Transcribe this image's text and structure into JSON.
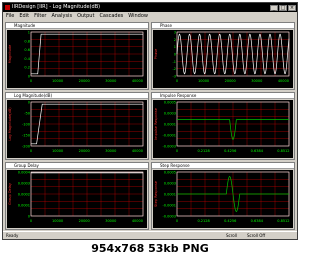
{
  "window": {
    "title": "IIRDesign [IIR] - Log Magnitude(dB)"
  },
  "menu": [
    "File",
    "Edit",
    "Filter",
    "Analysis",
    "Output",
    "Cascades",
    "Window"
  ],
  "panels": [
    {
      "title": "Magnitude",
      "ylabels": [
        "1",
        "0.8",
        "0.6",
        "0.4",
        "0.2",
        "0"
      ],
      "xlabels": [
        "0",
        "10000",
        "20000",
        "30000",
        "40000"
      ],
      "ylabel": "Magnitude"
    },
    {
      "title": "Phase",
      "ylabels": [
        "3",
        "2",
        "1",
        "0",
        "-1",
        "-2",
        "-3"
      ],
      "xlabels": [
        "0",
        "10000",
        "20000",
        "30000",
        "40000"
      ],
      "ylabel": "Phase"
    },
    {
      "title": "Log Magnitude(dB)",
      "ylabels": [
        "0",
        "-50",
        "-100",
        "-150",
        "-200"
      ],
      "xlabels": [
        "0",
        "10000",
        "20000",
        "30000",
        "40000"
      ],
      "ylabel": "Log Magnitude(dB)"
    },
    {
      "title": "Impulse Response",
      "ylabels": [
        "0.0005",
        "0.0003",
        "0.0001",
        "-0.0001",
        "-0.0003"
      ],
      "xlabels": [
        "0",
        "0.2128",
        "0.4256",
        "0.6384",
        "0.8512"
      ],
      "ylabel": "Impulse Response"
    },
    {
      "title": "Group Delay",
      "ylabels": [
        "0.0004",
        "0.0003",
        "0.0002",
        "0.0001",
        "0"
      ],
      "xlabels": [
        "0",
        "10000",
        "20000",
        "30000",
        "40000"
      ],
      "ylabel": "Group Delay"
    },
    {
      "title": "Step Response",
      "ylabels": [
        "0.0005",
        "0.0003",
        "0.0001",
        "-0.0001",
        "-0.0003"
      ],
      "xlabels": [
        "0",
        "0.2128",
        "0.4256",
        "0.6384",
        "0.8512"
      ],
      "ylabel": "Step Response"
    }
  ],
  "status": {
    "left": "Ready",
    "right1": "Scroll",
    "right2": "Scroll Off"
  },
  "caption": "954x768 53kb PNG",
  "colors": {
    "plot_bg": "#000000",
    "grid": "#c00000",
    "trace": "#ffffff",
    "trace_alt": "#00c000",
    "axis_text": "#00ff00"
  }
}
